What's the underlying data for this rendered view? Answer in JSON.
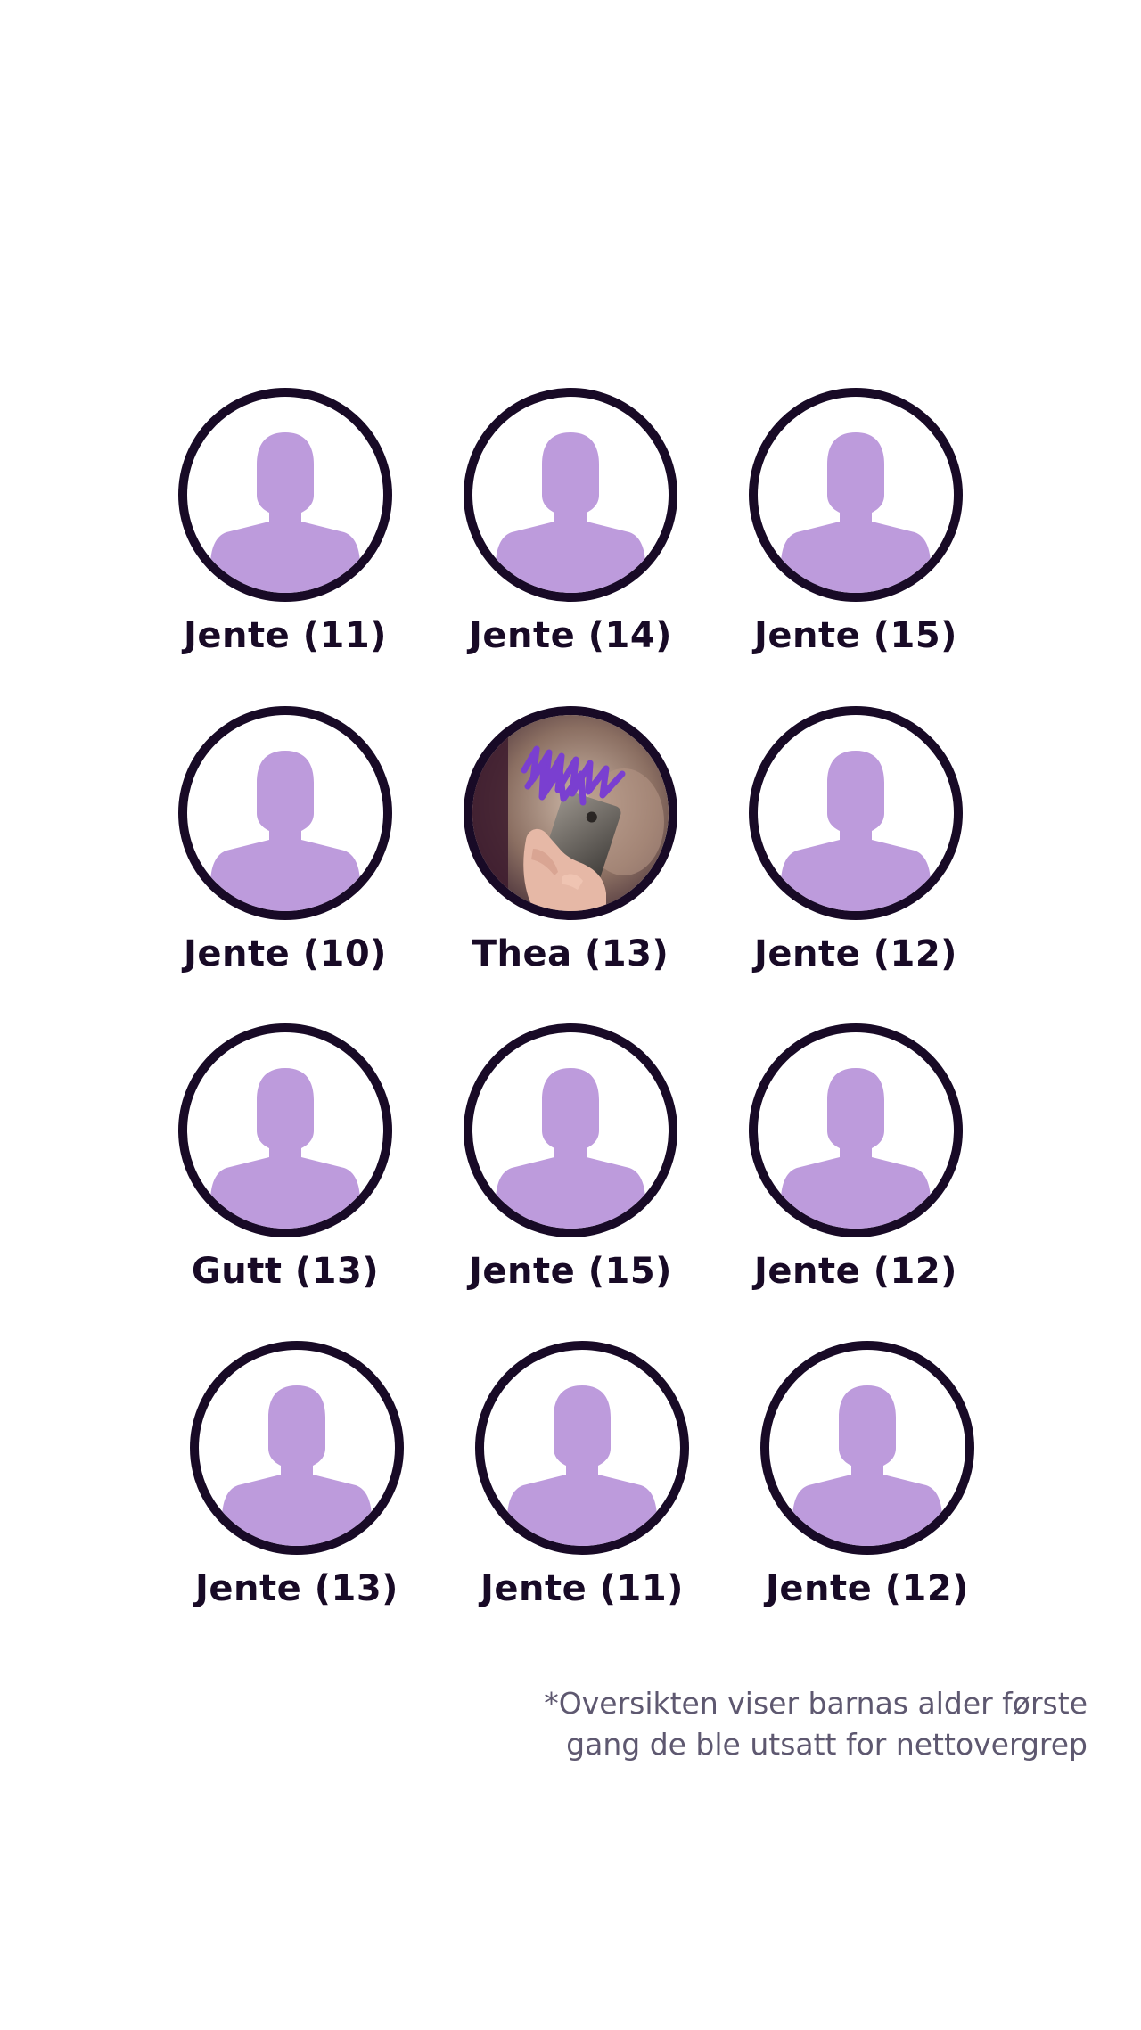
{
  "colors": {
    "ring": "#180a26",
    "silhouette": "#bd9bdc",
    "label": "#180a26",
    "footnote": "#5e5870",
    "scribble": "#7a3fd0"
  },
  "avatars": [
    {
      "label": "Jente (11)",
      "icon": "person-silhouette-icon"
    },
    {
      "label": "Jente (14)",
      "icon": "person-silhouette-icon"
    },
    {
      "label": "Jente (15)",
      "icon": "person-silhouette-icon"
    },
    {
      "label": "Jente (10)",
      "icon": "person-silhouette-icon"
    },
    {
      "label": "Thea (13)",
      "icon": "photo-hand-holding-phone"
    },
    {
      "label": "Jente (12)",
      "icon": "person-silhouette-icon"
    },
    {
      "label": "Gutt (13)",
      "icon": "person-silhouette-icon"
    },
    {
      "label": "Jente (15)",
      "icon": "person-silhouette-icon"
    },
    {
      "label": "Jente (12)",
      "icon": "person-silhouette-icon"
    },
    {
      "label": "Jente (13)",
      "icon": "person-silhouette-icon"
    },
    {
      "label": "Jente (11)",
      "icon": "person-silhouette-icon"
    },
    {
      "label": "Jente (12)",
      "icon": "person-silhouette-icon"
    }
  ],
  "footnote": {
    "line1": "*Oversikten viser barnas alder første",
    "line2": "gang de ble utsatt for nettovergrep"
  }
}
